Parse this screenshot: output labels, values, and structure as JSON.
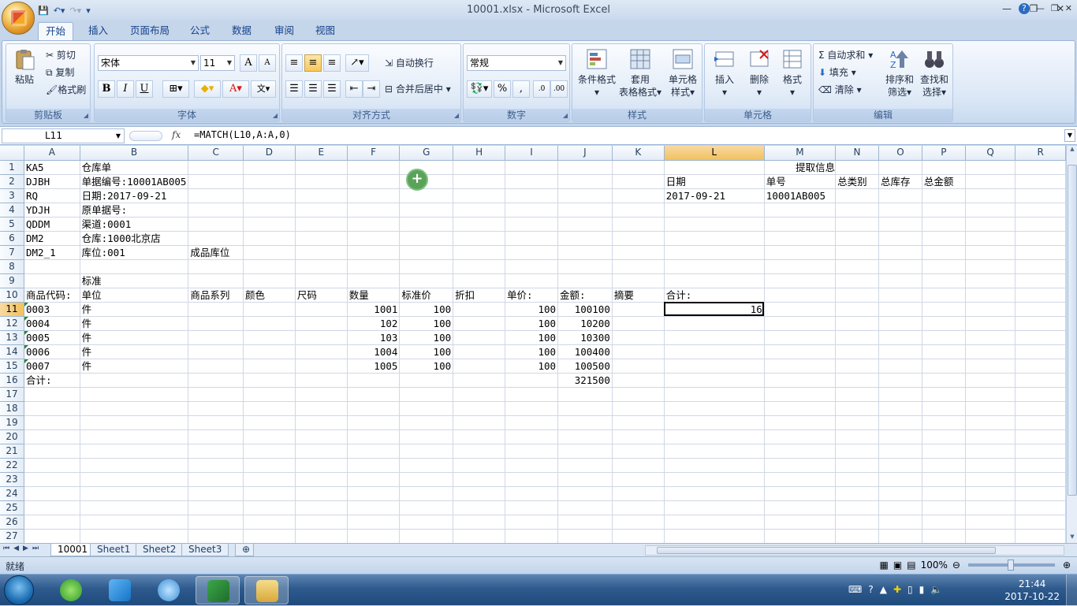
{
  "window": {
    "title": "10001.xlsx - Microsoft Excel"
  },
  "ribbon_tabs": [
    "开始",
    "插入",
    "页面布局",
    "公式",
    "数据",
    "审阅",
    "视图"
  ],
  "ribbon": {
    "clipboard": {
      "paste": "粘贴",
      "cut": "剪切",
      "copy": "复制",
      "format_painter": "格式刷",
      "label": "剪贴板"
    },
    "font": {
      "name": "宋体",
      "size": "11",
      "bold": "B",
      "italic": "I",
      "underline": "U",
      "label": "字体"
    },
    "alignment": {
      "wrap": "自动换行",
      "merge": "合并后居中",
      "label": "对齐方式"
    },
    "number": {
      "format": "常规",
      "percent": "%",
      "comma": ",",
      "label": "数字"
    },
    "styles": {
      "conditional": "条件格式",
      "table_line1": "套用",
      "table_line2": "表格格式",
      "cell_line1": "单元格",
      "cell_line2": "样式",
      "label": "样式"
    },
    "cells": {
      "insert": "插入",
      "delete": "删除",
      "format": "格式",
      "label": "单元格"
    },
    "editing": {
      "autosum": "自动求和",
      "fill": "填充",
      "clear": "清除",
      "sort_line1": "排序和",
      "sort_line2": "筛选",
      "find_line1": "查找和",
      "find_line2": "选择",
      "label": "编辑"
    }
  },
  "formula_bar": {
    "name_box": "L11",
    "fx": "fx",
    "formula": "=MATCH(L10,A:A,0)"
  },
  "columns": [
    "A",
    "B",
    "C",
    "D",
    "E",
    "F",
    "G",
    "H",
    "I",
    "J",
    "K",
    "L",
    "M",
    "N",
    "O",
    "P",
    "Q",
    "R"
  ],
  "selected_column": "L",
  "selected_row": "11",
  "rows": [
    {
      "n": "1",
      "c": {
        "A": "KA5",
        "B": "仓库单",
        "M": "提取信息"
      }
    },
    {
      "n": "2",
      "c": {
        "A": "DJBH",
        "B": "单据编号:10001AB005",
        "L": "日期",
        "M": "单号",
        "N": "总类别",
        "O": "总库存",
        "P": "总金额"
      }
    },
    {
      "n": "3",
      "c": {
        "A": "RQ",
        "B": "日期:2017-09-21",
        "L": "2017-09-21",
        "M": "10001AB005"
      }
    },
    {
      "n": "4",
      "c": {
        "A": "YDJH",
        "B": "原单据号:"
      }
    },
    {
      "n": "5",
      "c": {
        "A": "QDDM",
        "B": "渠道:0001"
      }
    },
    {
      "n": "6",
      "c": {
        "A": "DM2",
        "B": "仓库:1000北京店"
      }
    },
    {
      "n": "7",
      "c": {
        "A": "DM2_1",
        "B": "库位:001",
        "C": "成品库位"
      }
    },
    {
      "n": "8",
      "c": {}
    },
    {
      "n": "9",
      "c": {
        "B": "标准"
      }
    },
    {
      "n": "10",
      "c": {
        "A": "商品代码:",
        "B": "单位",
        "C": "商品系列",
        "D": "颜色",
        "E": "尺码",
        "F": "数量",
        "G": "标准价",
        "H": "折扣",
        "I": "单价:",
        "J": "金额:",
        "K": "摘要",
        "L": "合计:"
      }
    },
    {
      "n": "11",
      "c": {
        "A": "0003",
        "B": "件",
        "F": "1001",
        "G": "100",
        "I": "100",
        "J": "100100",
        "L": "16"
      }
    },
    {
      "n": "12",
      "c": {
        "A": "0004",
        "B": "件",
        "F": "102",
        "G": "100",
        "I": "100",
        "J": "10200"
      }
    },
    {
      "n": "13",
      "c": {
        "A": "0005",
        "B": "件",
        "F": "103",
        "G": "100",
        "I": "100",
        "J": "10300"
      }
    },
    {
      "n": "14",
      "c": {
        "A": "0006",
        "B": "件",
        "F": "1004",
        "G": "100",
        "I": "100",
        "J": "100400"
      }
    },
    {
      "n": "15",
      "c": {
        "A": "0007",
        "B": "件",
        "F": "1005",
        "G": "100",
        "I": "100",
        "J": "100500"
      }
    },
    {
      "n": "16",
      "c": {
        "A": "合计:",
        "J": "321500"
      }
    },
    {
      "n": "17",
      "c": {}
    },
    {
      "n": "18",
      "c": {}
    },
    {
      "n": "19",
      "c": {}
    },
    {
      "n": "20",
      "c": {}
    },
    {
      "n": "21",
      "c": {}
    },
    {
      "n": "22",
      "c": {}
    },
    {
      "n": "23",
      "c": {}
    },
    {
      "n": "24",
      "c": {}
    },
    {
      "n": "25",
      "c": {}
    },
    {
      "n": "26",
      "c": {}
    },
    {
      "n": "27",
      "c": {}
    }
  ],
  "sheet_tabs": [
    "10001",
    "Sheet1",
    "Sheet2",
    "Sheet3"
  ],
  "active_sheet": "10001",
  "status": {
    "ready": "就绪",
    "zoom": "100%"
  },
  "taskbar": {
    "time": "21:44",
    "date": "2017-10-22"
  }
}
